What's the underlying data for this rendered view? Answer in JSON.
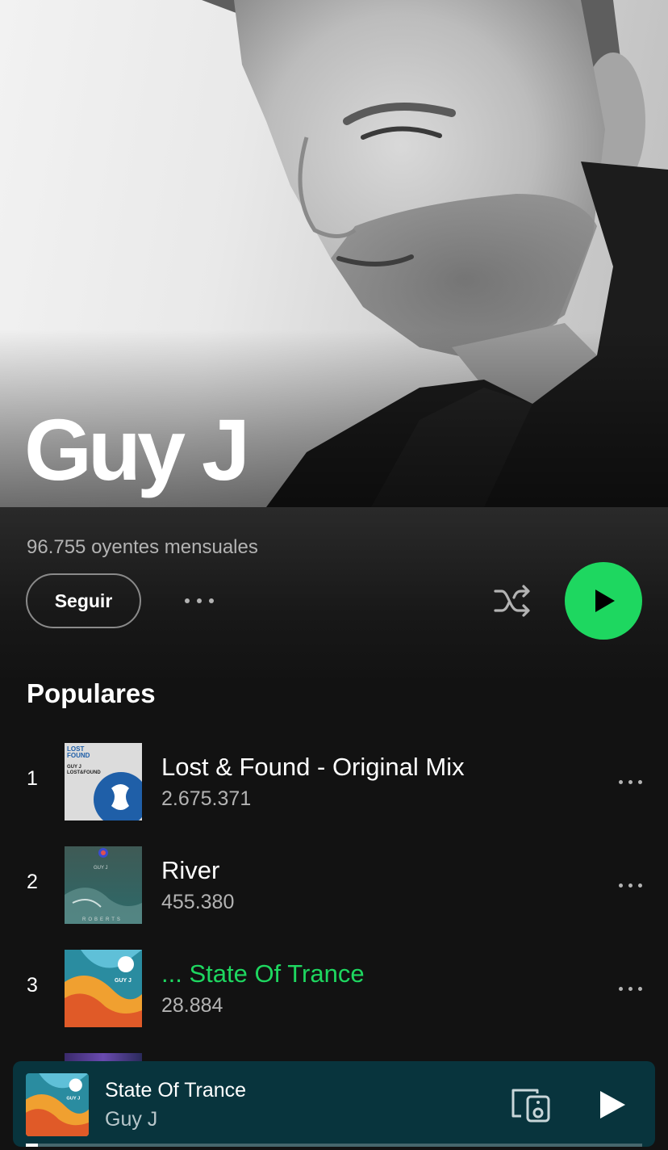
{
  "artist": {
    "name": "Guy J",
    "monthly_listeners": "96.755 oyentes mensuales"
  },
  "actions": {
    "follow_label": "Seguir",
    "more_icon": "more-horizontal-icon",
    "shuffle_icon": "shuffle-icon",
    "play_icon": "play-icon"
  },
  "popular": {
    "title": "Populares",
    "tracks": [
      {
        "number": "1",
        "title": "Lost & Found - Original Mix",
        "plays": "2.675.371",
        "active": false
      },
      {
        "number": "2",
        "title": "River",
        "plays": "455.380",
        "active": false
      },
      {
        "number": "3",
        "title": "... State Of Trance",
        "plays": "28.884",
        "active": true
      }
    ]
  },
  "covers": {
    "lost_found": {
      "line1": "LOST",
      "line2": "FOUND",
      "line3": "GUY J",
      "line4": "LOST&FOUND"
    },
    "river": {
      "artist": "GUY J",
      "footer": "ROBERTS"
    },
    "trance": {
      "artist": "GUY J"
    }
  },
  "now_playing": {
    "title": "State Of Trance",
    "artist": "Guy J",
    "progress": 0.02,
    "devices_icon": "connect-devices-icon",
    "play_icon": "play-icon"
  },
  "colors": {
    "accent": "#1ed760",
    "background": "#121212",
    "mini_player_bg": "#08343d",
    "secondary_text": "#b3b3b3"
  }
}
